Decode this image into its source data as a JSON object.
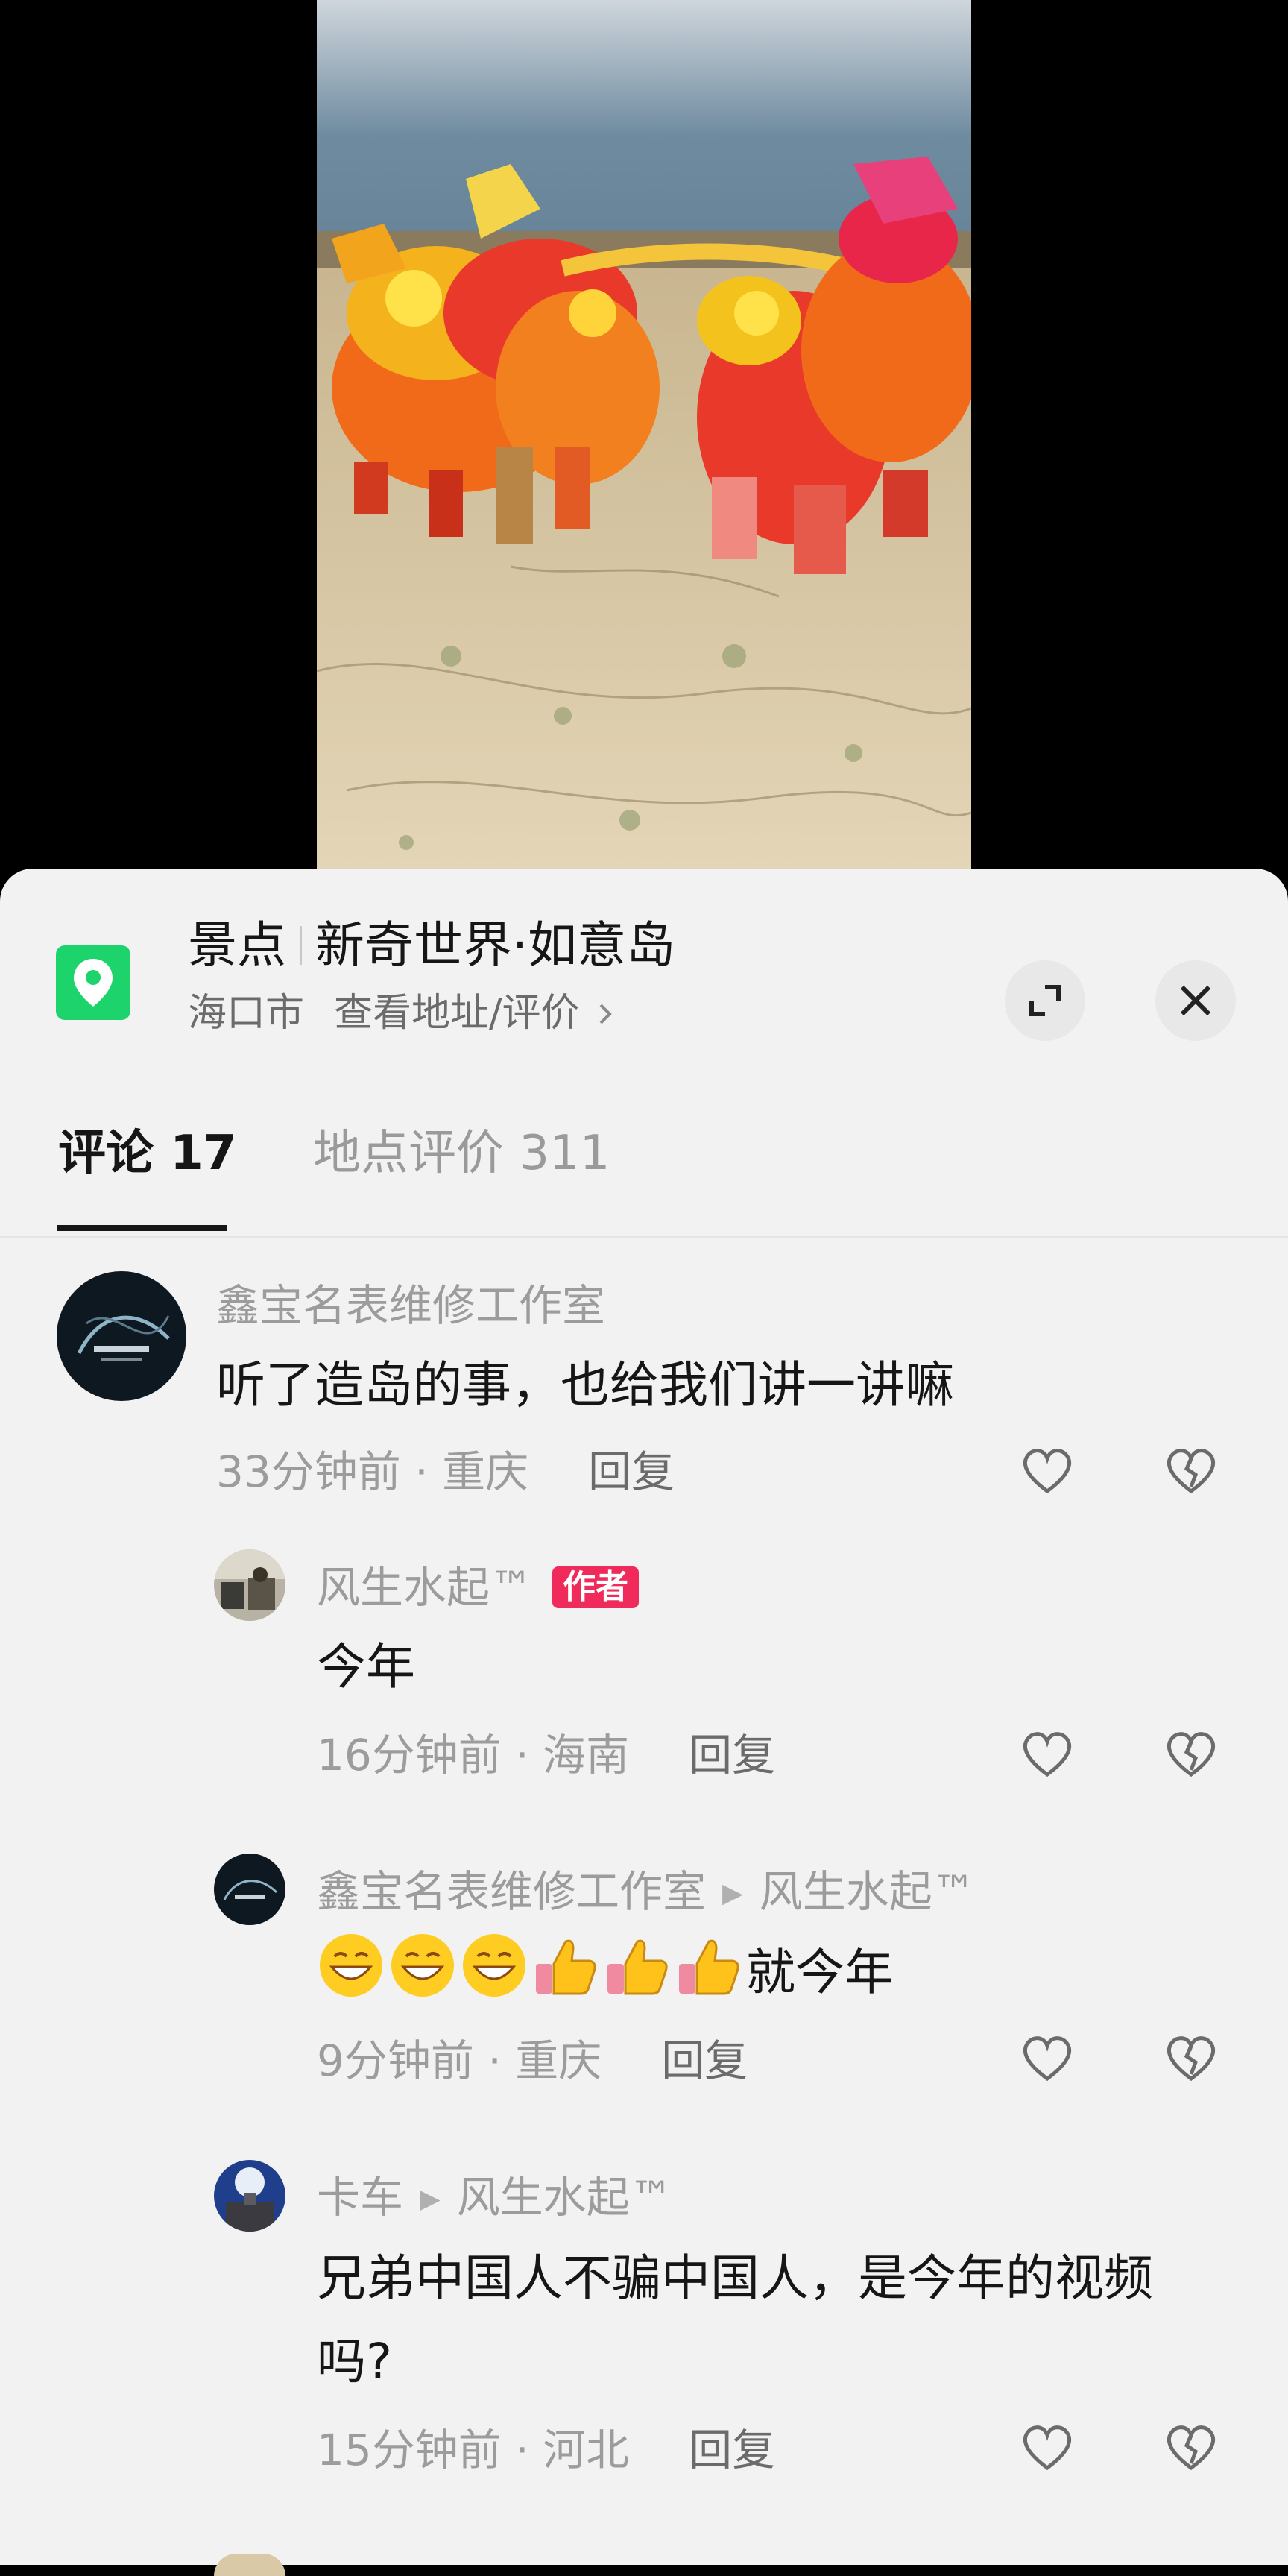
{
  "location": {
    "category": "景点",
    "name": "新奇世界·如意岛",
    "city": "海口市",
    "link": "查看地址/评价"
  },
  "icons": {
    "pin": "location-pin-icon",
    "expand": "expand-icon",
    "close": "close-icon",
    "like": "heart-outline-icon",
    "dislike": "broken-heart-icon",
    "chevron": "chevron-right-icon"
  },
  "colors": {
    "pin_green": "#1dd36c",
    "author_badge": "#f02a5a"
  },
  "tabs": [
    {
      "label": "评论 17",
      "active": true
    },
    {
      "label": "地点评价 311",
      "active": false
    }
  ],
  "comments": [
    {
      "user": "鑫宝名表维修工作室",
      "text": "听了造岛的事，也给我们讲一讲嘛",
      "time": "33分钟前 · 重庆",
      "reply": "回复"
    },
    {
      "user": "风生水起™",
      "badge": "作者",
      "text": "今年",
      "time": "16分钟前 · 海南",
      "reply": "回复"
    },
    {
      "user": "鑫宝名表维修工作室",
      "reply_to": "风生水起™",
      "text": "就今年",
      "emojis": [
        "grin-emoji",
        "grin-emoji",
        "grin-emoji",
        "thumbs-up-emoji",
        "thumbs-up-emoji",
        "thumbs-up-emoji"
      ],
      "time": "9分钟前 · 重庆",
      "reply": "回复"
    },
    {
      "user": "卡车",
      "reply_to": "风生水起™",
      "text_line1": "兄弟中国人不骗中国人，是今年的视频",
      "text_line2": "吗?",
      "time": "15分钟前 · 河北",
      "reply": "回复"
    }
  ]
}
